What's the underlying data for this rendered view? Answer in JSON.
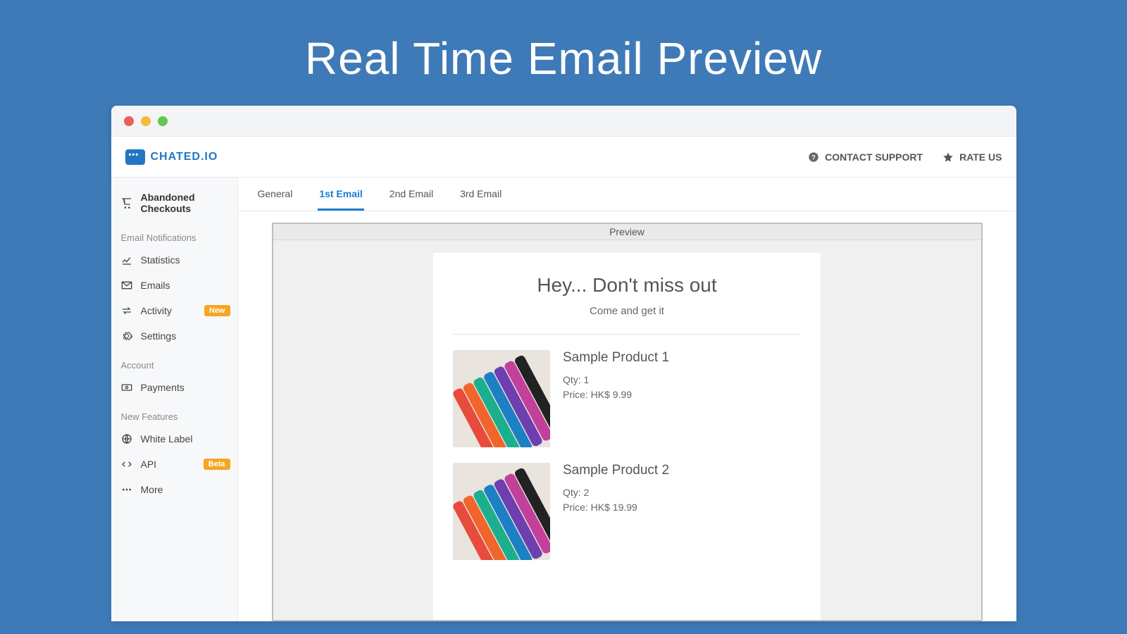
{
  "hero": {
    "title": "Real Time Email Preview"
  },
  "topbar": {
    "brand": "CHATED.IO",
    "contact": "CONTACT SUPPORT",
    "rate": "RATE US"
  },
  "sidebar": {
    "top_item": "Abandoned Checkouts",
    "sections": {
      "email": "Email Notifications",
      "account": "Account",
      "new_features": "New Features"
    },
    "items": {
      "statistics": "Statistics",
      "emails": "Emails",
      "activity": "Activity",
      "activity_badge": "New",
      "settings": "Settings",
      "payments": "Payments",
      "white_label": "White Label",
      "api": "API",
      "api_badge": "Beta",
      "more": "More"
    }
  },
  "tabs": {
    "general": "General",
    "first": "1st Email",
    "second": "2nd Email",
    "third": "3rd Email"
  },
  "preview": {
    "label": "Preview",
    "headline": "Hey... Don't miss out",
    "tagline": "Come and get it",
    "products": [
      {
        "name": "Sample Product 1",
        "qty": "Qty: 1",
        "price": "Price: HK$ 9.99"
      },
      {
        "name": "Sample Product 2",
        "qty": "Qty: 2",
        "price": "Price: HK$ 19.99"
      }
    ]
  }
}
